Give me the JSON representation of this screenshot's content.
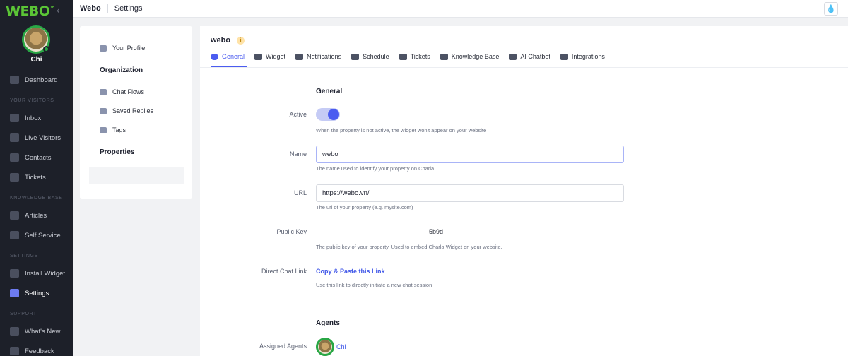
{
  "brand": {
    "name": "WEBO",
    "mark": "™"
  },
  "user": {
    "name": "Chi"
  },
  "sidebar": {
    "items": [
      {
        "label": "Dashboard"
      },
      {
        "label": "Inbox"
      },
      {
        "label": "Live Visitors"
      },
      {
        "label": "Contacts"
      },
      {
        "label": "Tickets"
      },
      {
        "label": "Articles"
      },
      {
        "label": "Self Service"
      },
      {
        "label": "Install Widget"
      },
      {
        "label": "Settings",
        "active": true
      },
      {
        "label": "What's New"
      },
      {
        "label": "Feedback"
      }
    ],
    "sections": [
      "YOUR VISITORS",
      "KNOWLEDGE BASE",
      "SETTINGS",
      "SUPPORT"
    ]
  },
  "topbar": {
    "crumb1": "Webo",
    "crumb2": "Settings"
  },
  "panel": {
    "your_profile": "Your Profile",
    "organization": "Organization",
    "chat_flows": "Chat Flows",
    "saved_replies": "Saved Replies",
    "tags": "Tags",
    "properties": "Properties"
  },
  "property": {
    "title": "webo",
    "info": "i",
    "tabs": [
      {
        "label": "General",
        "active": true
      },
      {
        "label": "Widget"
      },
      {
        "label": "Notifications"
      },
      {
        "label": "Schedule"
      },
      {
        "label": "Tickets"
      },
      {
        "label": "Knowledge Base"
      },
      {
        "label": "AI Chatbot"
      },
      {
        "label": "Integrations"
      }
    ]
  },
  "general": {
    "title": "General",
    "active_label": "Active",
    "active_value": true,
    "active_help": "When the property is not active, the widget won't appear on your website",
    "name_label": "Name",
    "name_value": "webo",
    "name_help": "The name used to identify your property on Charla.",
    "url_label": "URL",
    "url_value": "https://webo.vn/",
    "url_help": "The url of your property (e.g. mysite.com)",
    "pubkey_label": "Public Key",
    "pubkey_value": "5b9d",
    "pubkey_help": "The public key of your property. Used to embed Charla Widget on your website.",
    "chatlink_label": "Direct Chat Link",
    "chatlink_value": "Copy & Paste this Link",
    "chatlink_help": "Use this link to directly initiate a new chat session"
  },
  "agents": {
    "title": "Agents",
    "assigned_label": "Assigned Agents",
    "assigned": [
      "Chi"
    ]
  },
  "colors": {
    "accent": "#4b5cf0",
    "sidebar_bg": "#1d2029",
    "brand_green": "#5bc536",
    "online": "#29a745"
  }
}
